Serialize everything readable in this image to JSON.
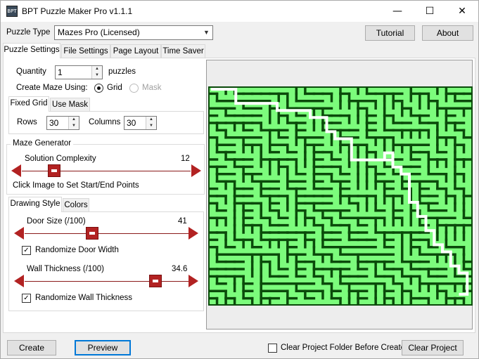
{
  "window": {
    "title": "BPT Puzzle Maker Pro v1.1.1",
    "icon": "BPT"
  },
  "titlebar_buttons": {
    "minimize": "—",
    "maximize": "☐",
    "close": "✕"
  },
  "header": {
    "puzzle_type_label": "Puzzle Type",
    "puzzle_type_value": "Mazes Pro (Licensed)",
    "tutorial": "Tutorial",
    "about": "About"
  },
  "tabs": [
    "Puzzle Settings",
    "File Settings",
    "Page Layout",
    "Time Saver"
  ],
  "settings": {
    "quantity_label": "Quantity",
    "quantity_value": "1",
    "quantity_unit": "puzzles",
    "create_using_label": "Create Maze Using:",
    "grid_label": "Grid",
    "mask_label": "Mask"
  },
  "grid_tabs": [
    "Fixed Grid",
    "Use Mask"
  ],
  "grid": {
    "rows_label": "Rows",
    "rows_value": "30",
    "columns_label": "Columns",
    "columns_value": "30"
  },
  "generator": {
    "title": "Maze Generator",
    "complexity_label": "Solution Complexity",
    "complexity_value": "12",
    "hint": "Click Image to Set Start/End Points"
  },
  "style_tabs": [
    "Drawing Style",
    "Colors"
  ],
  "style": {
    "door_label": "Door Size (/100)",
    "door_value": "41",
    "randomize_door": "Randomize Door Width",
    "wall_label": "Wall Thickness (/100)",
    "wall_value": "34.6",
    "randomize_wall": "Randomize Wall Thickness"
  },
  "sliders": {
    "complexity_fraction": 0.19,
    "door_fraction": 0.41,
    "wall_fraction": 0.8
  },
  "footer": {
    "create": "Create",
    "preview": "Preview",
    "clear_folder": "Clear Project Folder Before Create",
    "clear_project": "Clear Project"
  },
  "colors": {
    "accent": "#b22222",
    "maze_wall": "#0a4a0a",
    "maze_path": "#7cfc7c",
    "solution": "#ffffff"
  }
}
